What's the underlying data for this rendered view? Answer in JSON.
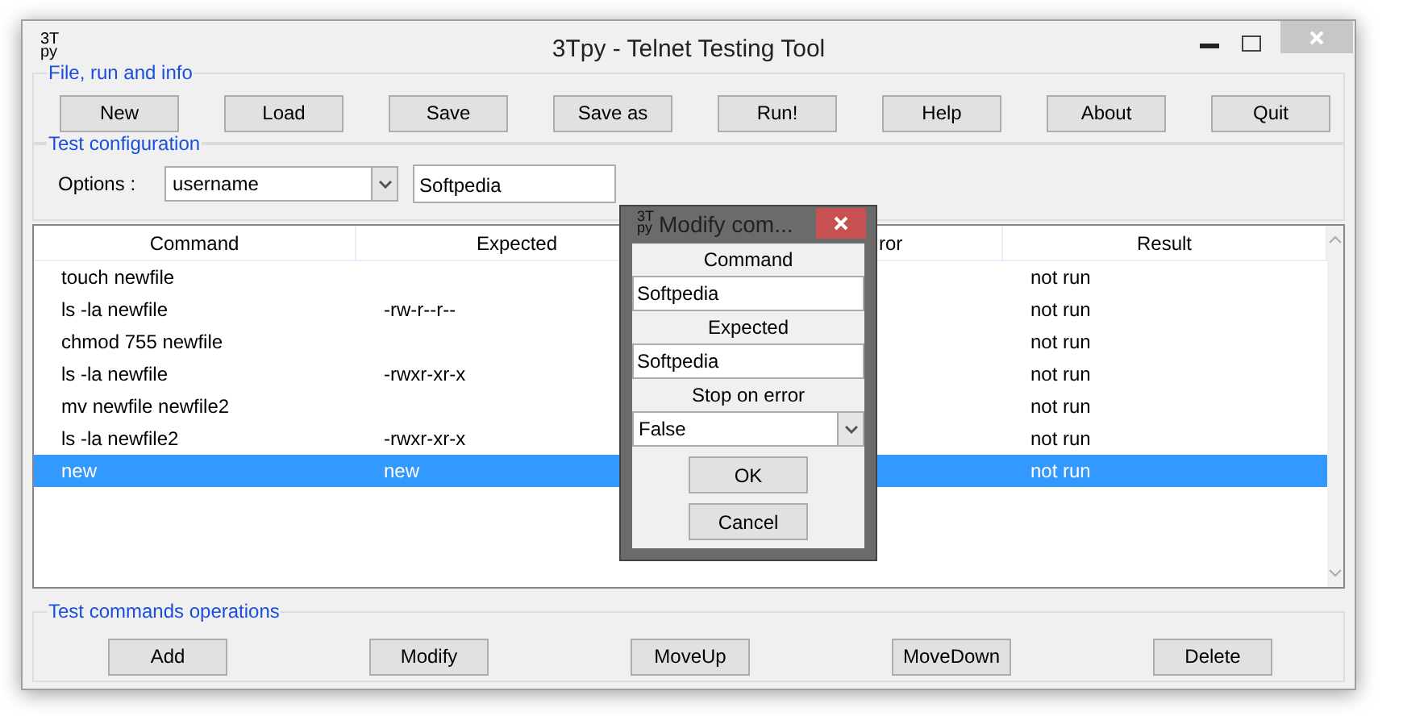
{
  "window": {
    "icon_text": "3T\npy",
    "title": "3Tpy - Telnet Testing Tool"
  },
  "file_group": {
    "label": "File, run and info",
    "buttons": [
      "New",
      "Load",
      "Save",
      "Save as",
      "Run!",
      "Help",
      "About",
      "Quit"
    ]
  },
  "config_group": {
    "label": "Test configuration",
    "options_label": "Options :",
    "options_value": "username",
    "value": "Softpedia"
  },
  "table": {
    "columns": [
      "Command",
      "Expected",
      "ror",
      "Result"
    ],
    "rows": [
      {
        "cells": [
          "touch newfile",
          "",
          "",
          "not run"
        ],
        "selected": false
      },
      {
        "cells": [
          "ls -la newfile",
          "-rw-r--r--",
          "",
          "not run"
        ],
        "selected": false
      },
      {
        "cells": [
          "chmod 755 newfile",
          "",
          "",
          "not run"
        ],
        "selected": false
      },
      {
        "cells": [
          "ls -la newfile",
          "-rwxr-xr-x",
          "",
          "not run"
        ],
        "selected": false
      },
      {
        "cells": [
          "mv newfile newfile2",
          "",
          "",
          "not run"
        ],
        "selected": false
      },
      {
        "cells": [
          "ls -la newfile2",
          "-rwxr-xr-x",
          "",
          "not run"
        ],
        "selected": false
      },
      {
        "cells": [
          "new",
          "new",
          "",
          "not run"
        ],
        "selected": true
      }
    ]
  },
  "ops_group": {
    "label": "Test commands operations",
    "buttons": [
      "Add",
      "Modify",
      "MoveUp",
      "MoveDown",
      "Delete"
    ]
  },
  "dialog": {
    "icon_text": "3T\npy",
    "title": "Modify com...",
    "command_label": "Command",
    "command_value": "Softpedia",
    "expected_label": "Expected",
    "expected_value": "Softpedia",
    "stop_label": "Stop on error",
    "stop_value": "False",
    "buttons": [
      "OK",
      "Cancel"
    ]
  }
}
